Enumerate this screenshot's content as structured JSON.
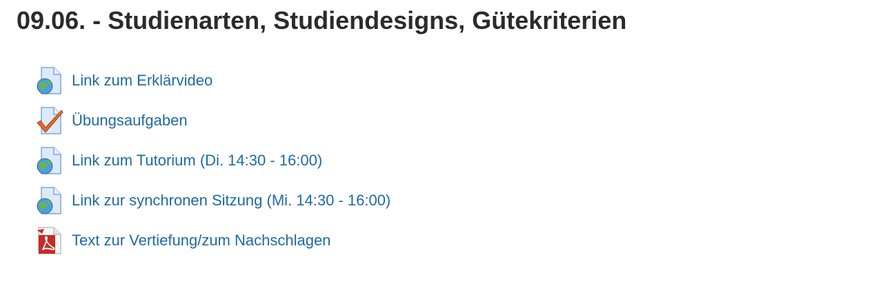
{
  "section": {
    "title": "09.06. - Studienarten, Studiendesigns, Gütekriterien"
  },
  "activities": [
    {
      "label": "Link zum Erklärvideo",
      "icon": "url-globe-icon"
    },
    {
      "label": "Übungsaufgaben",
      "icon": "assignment-check-icon"
    },
    {
      "label": "Link zum Tutorium (Di. 14:30 - 16:00)",
      "icon": "url-globe-icon"
    },
    {
      "label": "Link zur synchronen Sitzung (Mi. 14:30 - 16:00)",
      "icon": "url-globe-icon"
    },
    {
      "label": "Text zur Vertiefung/zum Nachschlagen",
      "icon": "pdf-file-icon"
    }
  ],
  "colors": {
    "link": "#1f6aa5",
    "heading": "#2b2b2b",
    "page_icon_fill": "#dde9f8",
    "page_icon_stroke": "#7aa7d8",
    "check": "#e06a2c",
    "globe": "#4e9fd8",
    "pdf": "#c52b25"
  }
}
